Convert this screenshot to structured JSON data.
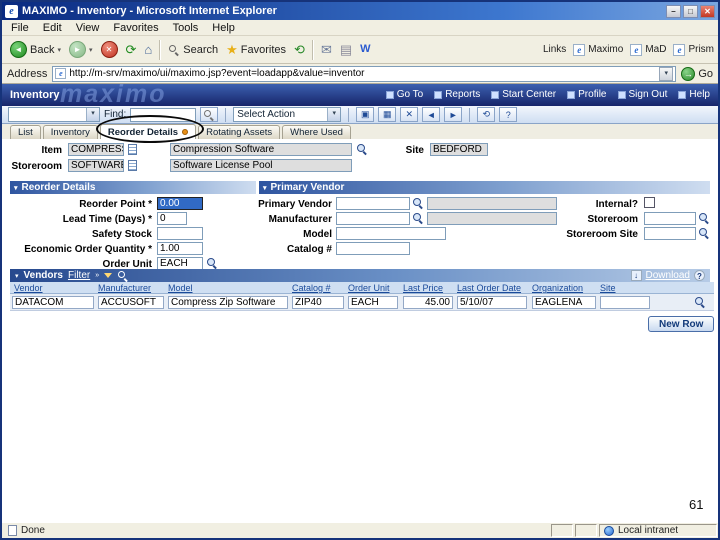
{
  "titlebar": {
    "title": "MAXIMO - Inventory - Microsoft Internet Explorer"
  },
  "icons": {
    "app_logo": "e",
    "minimize": "–",
    "maximize": "□",
    "close": "✕",
    "back_arrow": "◄",
    "forward_arrow": "►",
    "stop": "✕",
    "refresh": "⟳",
    "home": "⌂",
    "favorites_star": "★",
    "history": "⟲",
    "mail": "✉",
    "print": "▤",
    "edit": "W",
    "dropdown": "▾",
    "go_arrow": "→",
    "down_arrow": "↓",
    "help": "?",
    "collapse": "▾",
    "filter_arrow": "»",
    "new_record": "▣",
    "save": "▦",
    "clear": "✕",
    "prev": "◄",
    "next": "►"
  },
  "menu": {
    "items": [
      "File",
      "Edit",
      "View",
      "Favorites",
      "Tools",
      "Help"
    ]
  },
  "ie_toolbar": {
    "back_label": "Back",
    "search_label": "Search",
    "favorites_label": "Favorites",
    "links_label": "Links",
    "link_buttons": [
      "Maximo",
      "MaD",
      "Prism"
    ]
  },
  "address_bar": {
    "label": "Address",
    "url": "http://m-srv/maximo/ui/maximo.jsp?event=loadapp&value=inventor",
    "go_label": "Go"
  },
  "app_header": {
    "title": "Inventory",
    "watermark": "maximo",
    "links": [
      "Go To",
      "Reports",
      "Start Center",
      "Profile",
      "Sign Out",
      "Help"
    ]
  },
  "app_toolbar": {
    "query_value": "",
    "find_label": "Find:",
    "find_value": "",
    "select_action_label": "Select Action"
  },
  "tabs": {
    "items": [
      "List",
      "Inventory",
      "Reorder Details",
      "Rotating Assets",
      "Where Used"
    ]
  },
  "record": {
    "item": {
      "label": "Item",
      "value": "COMPRESS",
      "description": "Compression Software"
    },
    "storeroom": {
      "label": "Storeroom",
      "value": "SOFTWARE",
      "description": "Software License Pool"
    },
    "site": {
      "label": "Site",
      "value": "BEDFORD"
    }
  },
  "reorder_details": {
    "title": "Reorder Details",
    "reorder_point": {
      "label": "Reorder Point *",
      "value": "0.00"
    },
    "lead_time": {
      "label": "Lead Time (Days) *",
      "value": "0"
    },
    "safety_stock": {
      "label": "Safety Stock",
      "value": ""
    },
    "economic_order_quantity": {
      "label": "Economic Order Quantity *",
      "value": "1.00"
    },
    "order_unit": {
      "label": "Order Unit",
      "value": "EACH"
    }
  },
  "primary_vendor": {
    "title": "Primary Vendor",
    "vendor": {
      "label": "Primary Vendor",
      "value": ""
    },
    "manufacturer": {
      "label": "Manufacturer",
      "value": ""
    },
    "model": {
      "label": "Model",
      "value": ""
    },
    "catalog": {
      "label": "Catalog #",
      "value": ""
    },
    "internal": {
      "label": "Internal?",
      "checked": false
    },
    "storeroom": {
      "label": "Storeroom",
      "value": ""
    },
    "storeroom_site": {
      "label": "Storeroom Site",
      "value": ""
    }
  },
  "vendors": {
    "title": "Vendors",
    "filter_label": "Filter",
    "download_label": "Download",
    "columns": [
      "Vendor",
      "Manufacturer",
      "Model",
      "Catalog #",
      "Order Unit",
      "Last Price",
      "Last Order Date",
      "Organization",
      "Site"
    ],
    "row": {
      "vendor": "DATACOM",
      "manufacturer": "ACCUSOFT",
      "model": "Compress Zip Software",
      "catalog": "ZIP40",
      "order_unit": "EACH",
      "last_price": "45.00",
      "last_order_date": "5/10/07",
      "organization": "EAGLENA",
      "site": ""
    },
    "new_row_label": "New Row"
  },
  "status_bar": {
    "status": "Done",
    "zone": "Local intranet"
  },
  "slide_number": "61"
}
